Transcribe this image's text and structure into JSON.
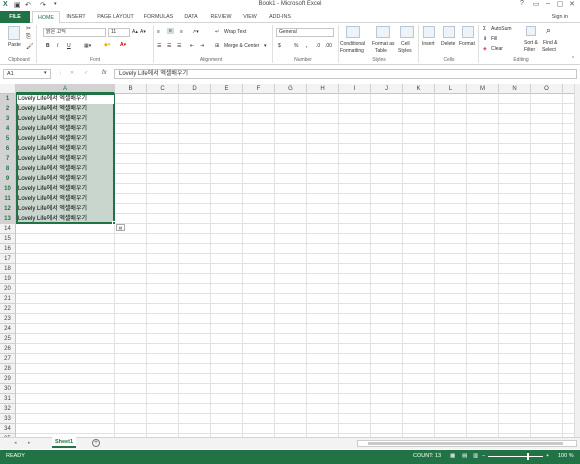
{
  "window": {
    "title": "Book1 - Microsoft Excel",
    "controls": [
      "?",
      "▭",
      "–",
      "▢",
      "✕"
    ]
  },
  "qat": {
    "save_icon": "save-icon",
    "undo_icon": "undo-icon",
    "redo_icon": "redo-icon"
  },
  "tabs": [
    "FILE",
    "HOME",
    "INSERT",
    "PAGE LAYOUT",
    "FORMULAS",
    "DATA",
    "REVIEW",
    "VIEW",
    "ADD-INS"
  ],
  "active_tab": "HOME",
  "sign_in": "Sign in",
  "ribbon": {
    "clipboard": {
      "paste": "Paste",
      "label": "Clipboard"
    },
    "font": {
      "name": "맑은 고딕",
      "size": "11",
      "bold": "B",
      "italic": "I",
      "underline": "U",
      "label": "Font"
    },
    "alignment": {
      "wrap": "Wrap Text",
      "merge": "Merge & Center",
      "label": "Alignment"
    },
    "number": {
      "format": "General",
      "currency": "$",
      "percent": "%",
      "comma": ",",
      "label": "Number"
    },
    "styles": {
      "conditional": "Conditional",
      "conditional2": "Formatting",
      "format_as": "Format as",
      "format_as2": "Table",
      "cell": "Cell",
      "cell2": "Styles",
      "label": "Styles"
    },
    "cells": {
      "insert": "Insert",
      "delete": "Delete",
      "format": "Format",
      "label": "Cells"
    },
    "editing": {
      "autosum": "AutoSum",
      "fill": "Fill",
      "clear": "Clear",
      "sort": "Sort &",
      "sort2": "Filter",
      "find": "Find &",
      "find2": "Select",
      "label": "Editing"
    }
  },
  "formula_bar": {
    "name_box": "A1",
    "fx": "fx",
    "content": "Lovely Life에서 엑셀배우기"
  },
  "columns": [
    "A",
    "B",
    "C",
    "D",
    "E",
    "F",
    "G",
    "H",
    "I",
    "J",
    "K",
    "L",
    "M",
    "N",
    "O"
  ],
  "rows": [
    "1",
    "2",
    "3",
    "4",
    "5",
    "6",
    "7",
    "8",
    "9",
    "10",
    "11",
    "12",
    "13",
    "14",
    "15",
    "16",
    "17",
    "18",
    "19",
    "20",
    "21",
    "22",
    "23",
    "24",
    "25",
    "26",
    "27",
    "28",
    "29",
    "30",
    "31",
    "32",
    "33",
    "34",
    "35"
  ],
  "cells_A": [
    "Lovely Life에서 엑셀배우기",
    "Lovely Life에서 엑셀배우기",
    "Lovely Life에서 엑셀배우기",
    "Lovely Life에서 엑셀배우기",
    "Lovely Life에서 엑셀배우기",
    "Lovely Life에서 엑셀배우기",
    "Lovely Life에서 엑셀배우기",
    "Lovely Life에서 엑셀배우기",
    "Lovely Life에서 엑셀배우기",
    "Lovely Life에서 엑셀배우기",
    "Lovely Life에서 엑셀배우기",
    "Lovely Life에서 엑셀배우기",
    "Lovely Life에서 엑셀배우기"
  ],
  "sheet_tab": "Sheet1",
  "add_sheet": "+",
  "status": {
    "ready": "READY",
    "count": "COUNT: 13",
    "zoom": "100 %",
    "minus": "–",
    "plus": "+"
  },
  "colors": {
    "accent": "#217346",
    "selection": "#c9d6cd"
  }
}
